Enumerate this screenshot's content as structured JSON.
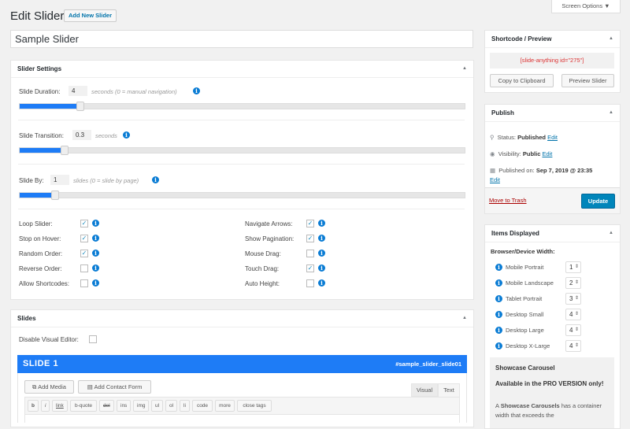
{
  "header": {
    "title": "Edit Slider",
    "add_new_label": "Add New Slider",
    "screen_options_label": "Screen Options",
    "slider_title_value": "Sample Slider"
  },
  "slider_settings": {
    "title": "Slider Settings",
    "duration": {
      "label": "Slide Duration:",
      "value": "4",
      "hint": "seconds (0 = manual navigation)",
      "slider_fraction": 0.135
    },
    "transition": {
      "label": "Slide Transition:",
      "value": "0.3",
      "hint": "seconds",
      "slider_fraction": 0.1
    },
    "slide_by": {
      "label": "Slide By:",
      "value": "1",
      "hint": "slides (0 = slide by page)",
      "slider_fraction": 0.08
    },
    "left_options": [
      {
        "label": "Loop Slider:",
        "checked": true
      },
      {
        "label": "Stop on Hover:",
        "checked": true
      },
      {
        "label": "Random Order:",
        "checked": true
      },
      {
        "label": "Reverse Order:",
        "checked": false
      },
      {
        "label": "Allow Shortcodes:",
        "checked": false
      }
    ],
    "right_options": [
      {
        "label": "Navigate Arrows:",
        "checked": true
      },
      {
        "label": "Show Pagination:",
        "checked": true
      },
      {
        "label": "Mouse Drag:",
        "checked": false
      },
      {
        "label": "Touch Drag:",
        "checked": true
      },
      {
        "label": "Auto Height:",
        "checked": false
      }
    ]
  },
  "slides": {
    "title": "Slides",
    "disable_visual_label": "Disable Visual Editor:",
    "slide_title": "SLIDE 1",
    "slide_id": "#sample_slider_slide01",
    "add_media_label": "Add Media",
    "add_contact_label": "Add Contact Form",
    "tab_visual": "Visual",
    "tab_text": "Text",
    "format_buttons": [
      "b",
      "i",
      "link",
      "b-quote",
      "del",
      "ins",
      "img",
      "ul",
      "ol",
      "li",
      "code",
      "more",
      "close tags"
    ]
  },
  "shortcode": {
    "title": "Shortcode / Preview",
    "code": "[slide-anything id=\"275\"]",
    "copy_label": "Copy to Clipboard",
    "preview_label": "Preview Slider"
  },
  "publish": {
    "title": "Publish",
    "status_label": "Status:",
    "status_value": "Published",
    "visibility_label": "Visibility:",
    "visibility_value": "Public",
    "published_label": "Published on:",
    "published_value": "Sep 7, 2019 @ 23:35",
    "edit_label": "Edit",
    "trash_label": "Move to Trash",
    "update_label": "Update"
  },
  "items_displayed": {
    "title": "Items Displayed",
    "subtitle": "Browser/Device Width:",
    "rows": [
      {
        "label": "Mobile Portrait",
        "value": "1"
      },
      {
        "label": "Mobile Landscape",
        "value": "2"
      },
      {
        "label": "Tablet Portrait",
        "value": "3"
      },
      {
        "label": "Desktop Small",
        "value": "4"
      },
      {
        "label": "Desktop Large",
        "value": "4"
      },
      {
        "label": "Desktop X-Large",
        "value": "4"
      }
    ],
    "promo_title": "Showcase Carousel",
    "promo_sub": "Available in the PRO VERSION only!",
    "promo_text_a": "A ",
    "promo_text_bold": "Showcase Carousels",
    "promo_text_b": " has a container width that exceeds the"
  }
}
